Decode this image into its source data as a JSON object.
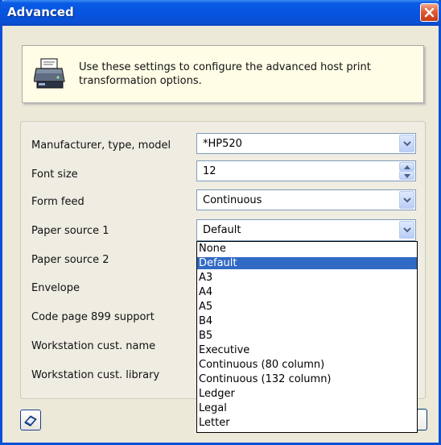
{
  "window": {
    "title": "Advanced"
  },
  "info": {
    "text": "Use these settings to configure the advanced host print transformation options."
  },
  "form": {
    "manufacturer": {
      "label": "Manufacturer, type, model",
      "value": "*HP520"
    },
    "font_size": {
      "label": "Font size",
      "value": "12"
    },
    "form_feed": {
      "label": "Form feed",
      "value": "Continuous"
    },
    "paper_source_1": {
      "label": "Paper source 1",
      "value": "Default"
    },
    "paper_source_2": {
      "label": "Paper source 2"
    },
    "envelope": {
      "label": "Envelope"
    },
    "code_page": {
      "label": "Code page 899 support"
    },
    "ws_cust_name": {
      "label": "Workstation cust. name"
    },
    "ws_cust_library": {
      "label": "Workstation cust. library"
    }
  },
  "dropdown": {
    "selected": "Default",
    "options": [
      "None",
      "Default",
      "A3",
      "A4",
      "A5",
      "B4",
      "B5",
      "Executive",
      "Continuous (80 column)",
      "Continuous (132 column)",
      "Ledger",
      "Legal",
      "Letter"
    ]
  },
  "icons": {
    "close": "close-icon",
    "printer": "printer-icon",
    "help": "help-book-icon",
    "dropdown": "chevron-down-icon",
    "spin_up": "spin-up-icon",
    "spin_down": "spin-down-icon"
  },
  "colors": {
    "titlebar": "#0654e0",
    "selection": "#316ac5",
    "info_background": "#fffde6",
    "close_button": "#e05a32"
  }
}
